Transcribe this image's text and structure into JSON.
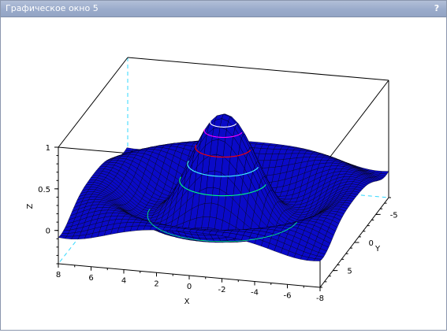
{
  "window": {
    "title": "Графическое окно 5",
    "help_label": "?"
  },
  "colors": {
    "surface": "#0a0ac8",
    "surface_mesh": "#000000",
    "axes": "#000000",
    "hidden_axes": "#30d8ff",
    "titlebar": "#9aabcb"
  },
  "chart_data": {
    "type": "surface",
    "title": "",
    "xlabel": "X",
    "ylabel": "Y",
    "zlabel": "Z",
    "x_ticks": [
      "8",
      "6",
      "4",
      "2",
      "0",
      "-2",
      "-4",
      "-6",
      "-8"
    ],
    "y_ticks": [
      "-5",
      "0",
      "5"
    ],
    "z_ticks": [
      "1",
      "0.5",
      "0"
    ],
    "xlim": [
      -8,
      8
    ],
    "ylim": [
      -8,
      8
    ],
    "zlim": [
      -0.4,
      1
    ],
    "contours": [
      {
        "level": 0.2,
        "color": "#00ff80"
      },
      {
        "level": 0.4,
        "color": "#40ffff"
      },
      {
        "level": 0.6,
        "color": "#ff0000"
      },
      {
        "level": 0.8,
        "color": "#ff00ff"
      },
      {
        "level": 0.9,
        "color": "#ffffff"
      },
      {
        "level": -0.2,
        "color": "#00ff80"
      }
    ]
  }
}
